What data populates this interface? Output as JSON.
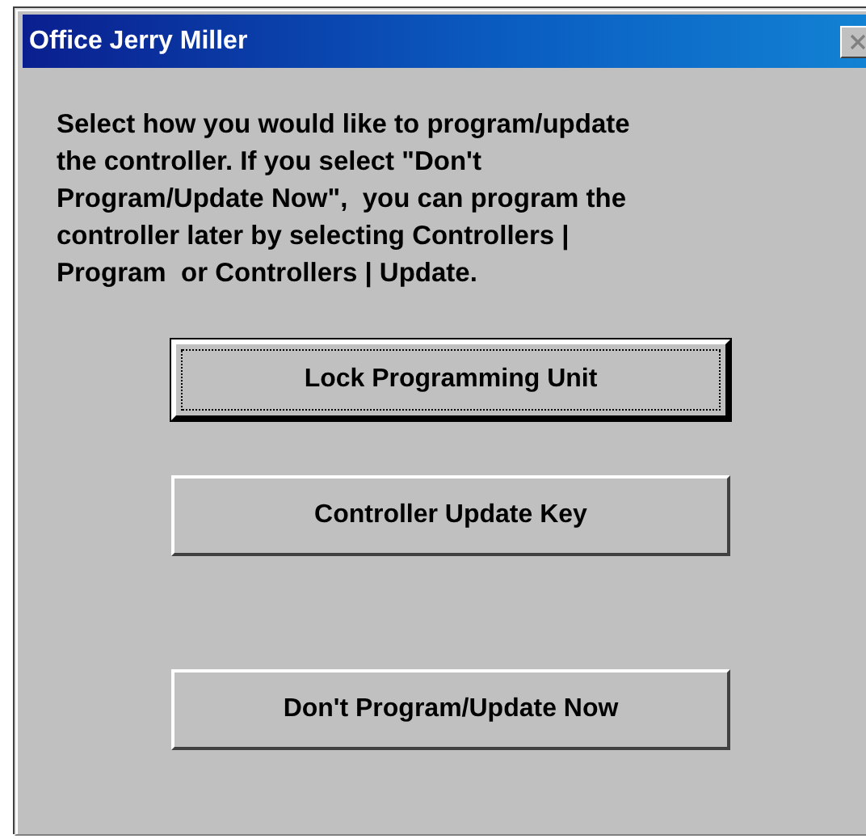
{
  "window": {
    "title": "Office Jerry Miller"
  },
  "message": "Select how you would like to program/update\nthe controller. If you select \"Don't\nProgram/Update Now\",  you can program the\ncontroller later by selecting Controllers |\nProgram  or Controllers | Update.",
  "buttons": [
    {
      "label": "Lock Programming Unit",
      "selected": true
    },
    {
      "label": "Controller Update Key",
      "selected": false
    },
    {
      "label": "Don't Program/Update Now",
      "selected": false
    }
  ]
}
